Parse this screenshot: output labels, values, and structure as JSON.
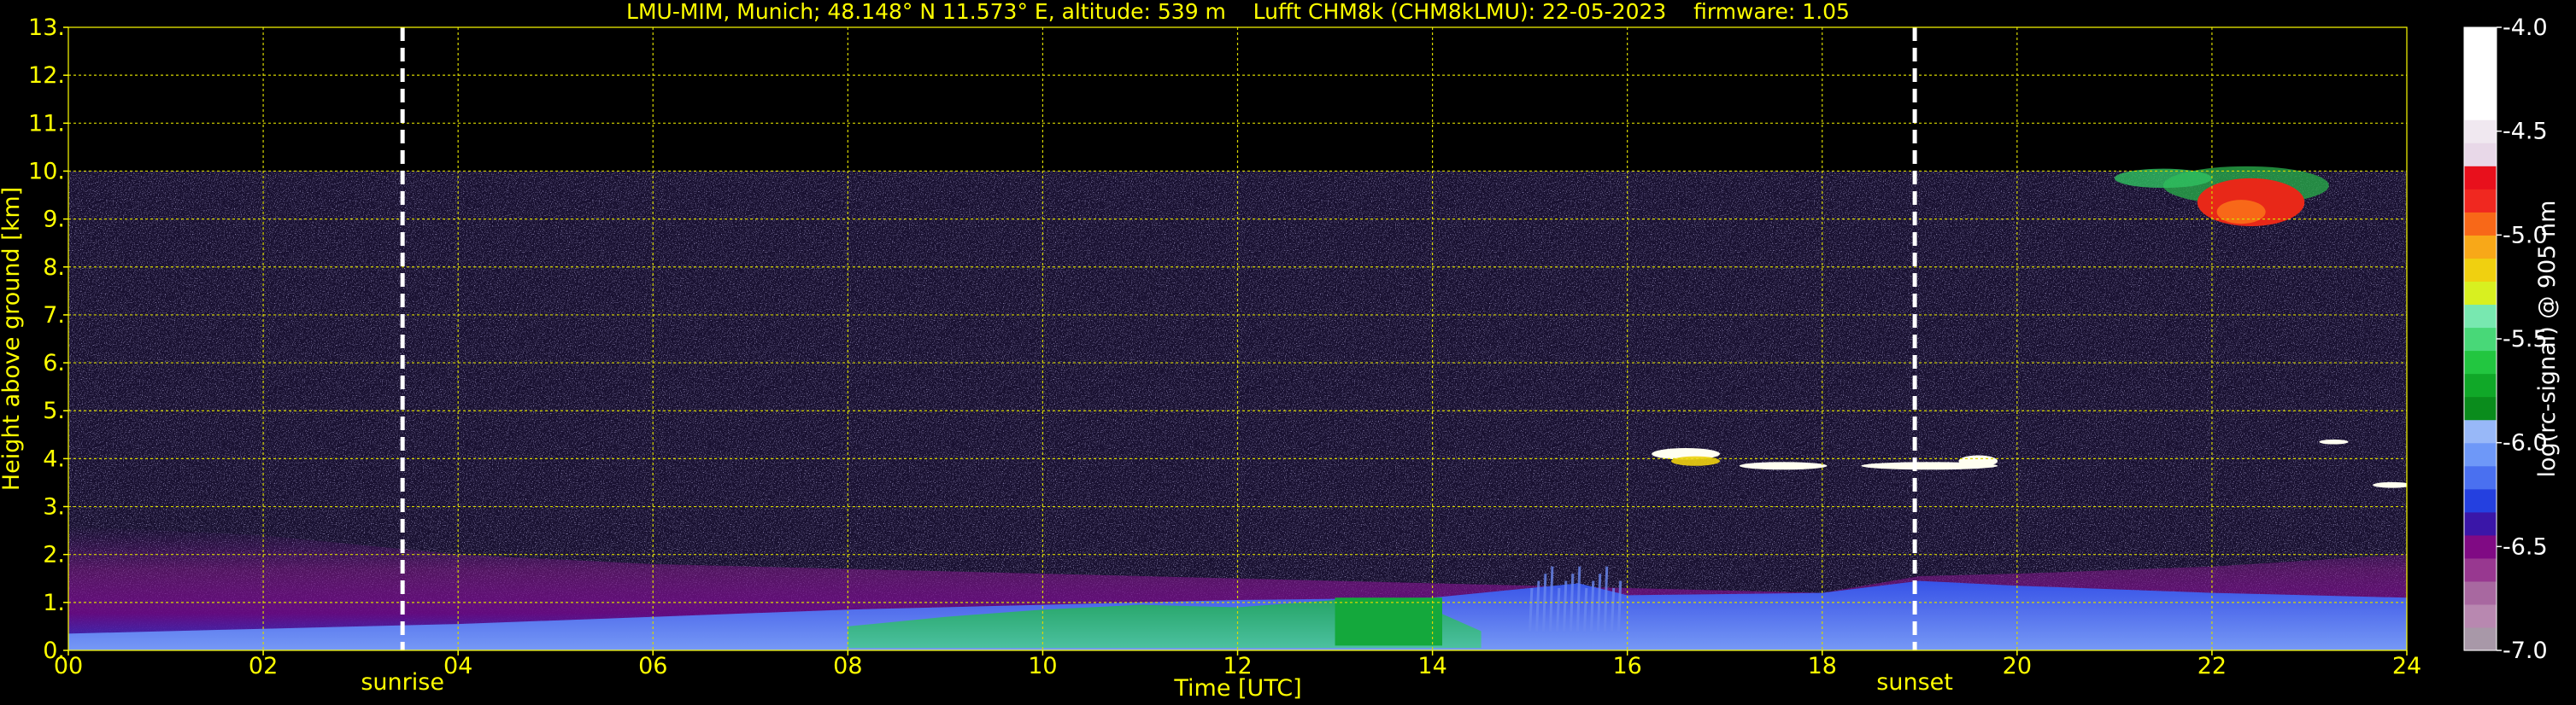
{
  "chart_data": {
    "type": "heatmap",
    "title": "LMU-MIM, Munich; 48.148° N 11.573° E, altitude: 539 m    Lufft CHM8k (CHM8kLMU): 22-05-2023    firmware: 1.05",
    "xlabel": "Time [UTC]",
    "ylabel": "Height above ground [km]",
    "colorbar_label": "log(rc-signal) @ 905 nm",
    "xlim": [
      0,
      24
    ],
    "ylim": [
      0,
      13
    ],
    "xticks": [
      "00",
      "02",
      "04",
      "06",
      "08",
      "10",
      "12",
      "14",
      "16",
      "18",
      "20",
      "22",
      "24"
    ],
    "yticks": [
      "0.",
      "1.",
      "2.",
      "3.",
      "4.",
      "5.",
      "6.",
      "7.",
      "8.",
      "9.",
      "10.",
      "11.",
      "12.",
      "13."
    ],
    "grid": true,
    "data_top_km": 10.0,
    "markers": [
      {
        "label": "sunrise",
        "time": 3.43
      },
      {
        "label": "sunset",
        "time": 18.95
      }
    ],
    "colorbar": {
      "min": -7.0,
      "max": -4.0,
      "ticks": [
        "-4.0",
        "-4.5",
        "-5.0",
        "-5.5",
        "-6.0",
        "-6.5",
        "-7.0"
      ],
      "colors": [
        "#a898a8",
        "#b888b0",
        "#a868a0",
        "#983890",
        "#800a84",
        "#3a16a8",
        "#2440e0",
        "#4a70f0",
        "#6e98f8",
        "#98b8f8",
        "#0a8c1c",
        "#10a828",
        "#22c640",
        "#48d878",
        "#78e8b0",
        "#d8f020",
        "#f0d010",
        "#f8a818",
        "#f86818",
        "#f02820",
        "#e8101c",
        "#e8d8e8",
        "#f0e8f0",
        "#ffffff",
        "#ffffff",
        "#ffffff",
        "#ffffff"
      ]
    },
    "features": [
      {
        "name": "boundary layer",
        "color": "#2a4ee8"
      },
      {
        "name": "residual layer",
        "color": "#7a1486"
      },
      {
        "name": "aerosol (green)",
        "color": "#14a83c"
      },
      {
        "name": "cloud (high)",
        "color": "#e82818"
      },
      {
        "name": "cloud (mid)",
        "color": "#fffff0"
      }
    ]
  }
}
